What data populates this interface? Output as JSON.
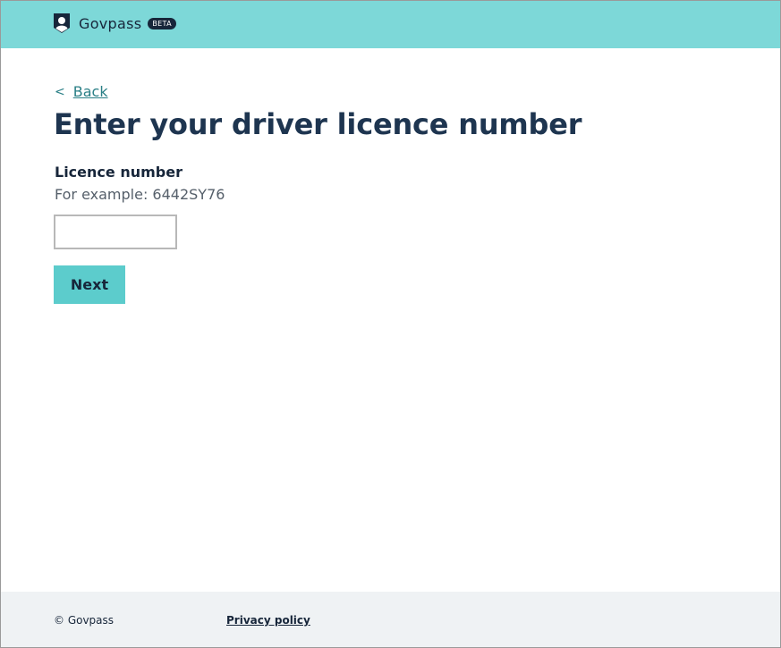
{
  "header": {
    "brand": "Govpass",
    "badge": "BETA",
    "logo_icon": "shield-person-icon",
    "background": "#7dd8d8"
  },
  "nav": {
    "back_chevron": "<",
    "back_label": "Back"
  },
  "main": {
    "title": "Enter your driver licence number",
    "field_label": "Licence number",
    "field_hint": "For example: 6442SY76",
    "input_value": "",
    "input_placeholder": "",
    "next_label": "Next",
    "button_color": "#5ccccc"
  },
  "footer": {
    "copyright": "© Govpass",
    "privacy_label": "Privacy policy"
  }
}
